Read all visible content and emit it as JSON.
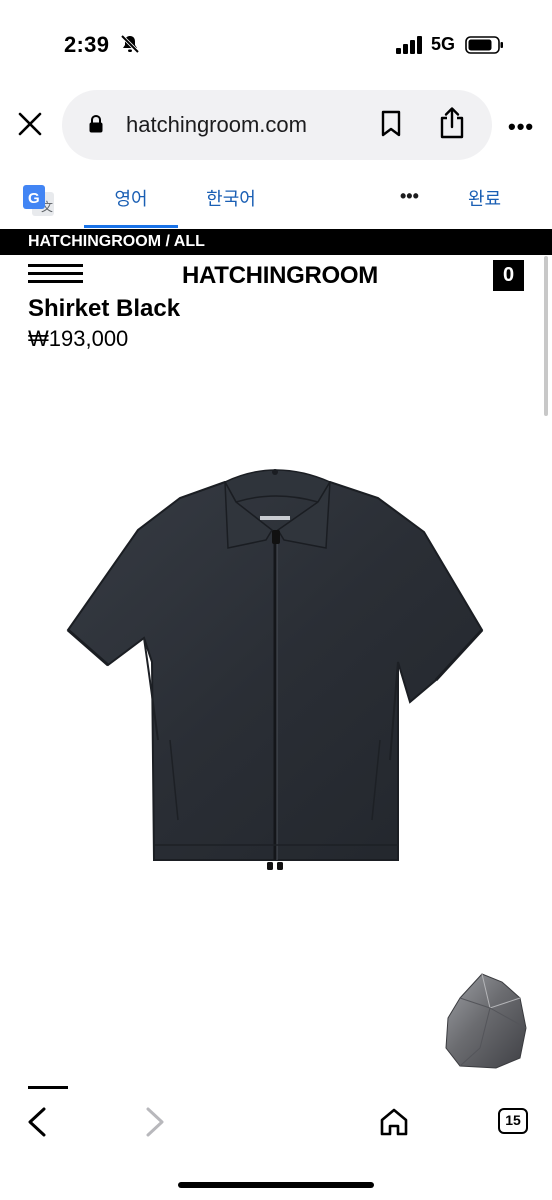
{
  "status_bar": {
    "time": "2:39",
    "network": "5G"
  },
  "browser": {
    "url": "hatchingroom.com",
    "tab_count": "15"
  },
  "translate": {
    "lang_source": "영어",
    "lang_target": "한국어",
    "more": "•••",
    "done": "완료"
  },
  "site": {
    "breadcrumb": "HATCHINGROOM / ALL",
    "brand": "HATCHINGROOM",
    "cart_count": "0",
    "product_name": "Shirket Black",
    "price": "₩193,000"
  },
  "colors": {
    "accent_link": "#1a5fb4",
    "shirt": "#2b2f36"
  }
}
